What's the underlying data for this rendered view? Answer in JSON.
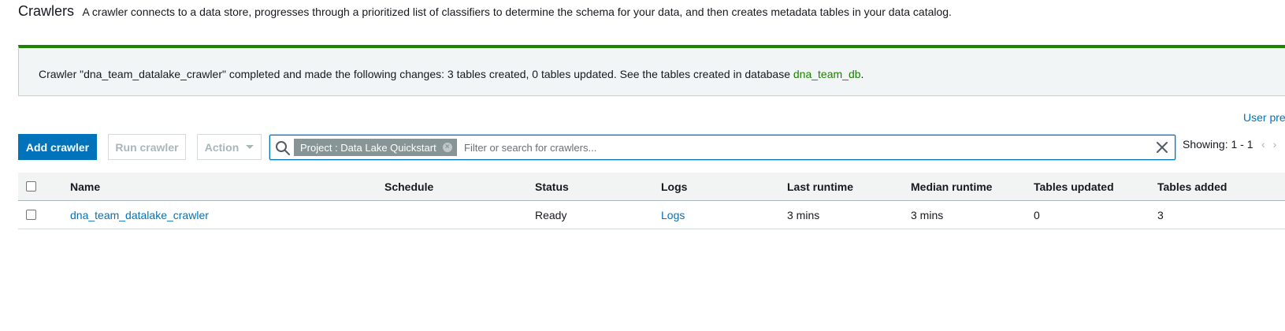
{
  "header": {
    "title": "Crawlers",
    "description": "A crawler connects to a data store, progresses through a prioritized list of classifiers to determine the schema for your data, and then creates metadata tables in your data catalog."
  },
  "banner": {
    "message": "Crawler \"dna_team_datalake_crawler\" completed and made the following changes: 3 tables created, 0 tables updated. See the tables created in database ",
    "database_link": "dna_team_db",
    "suffix": "."
  },
  "user_preferences_link": "User pre",
  "toolbar": {
    "add_label": "Add crawler",
    "run_label": "Run crawler",
    "action_label": "Action"
  },
  "search": {
    "token_label": "Project : Data Lake Quickstart",
    "placeholder": "Filter or search for crawlers...",
    "value": ""
  },
  "pagination": {
    "showing": "Showing: 1 - 1",
    "prev": "‹",
    "next": "›"
  },
  "table": {
    "columns": [
      "Name",
      "Schedule",
      "Status",
      "Logs",
      "Last runtime",
      "Median runtime",
      "Tables updated",
      "Tables added"
    ],
    "rows": [
      {
        "name": "dna_team_datalake_crawler",
        "schedule": "",
        "status": "Ready",
        "logs": "Logs",
        "last_runtime": "3 mins",
        "median_runtime": "3 mins",
        "tables_updated": "0",
        "tables_added": "3"
      }
    ]
  },
  "colors": {
    "primary": "#0073bb",
    "success": "#1d8102",
    "token_bg": "#879596",
    "disabled_text": "#aab7b8"
  }
}
